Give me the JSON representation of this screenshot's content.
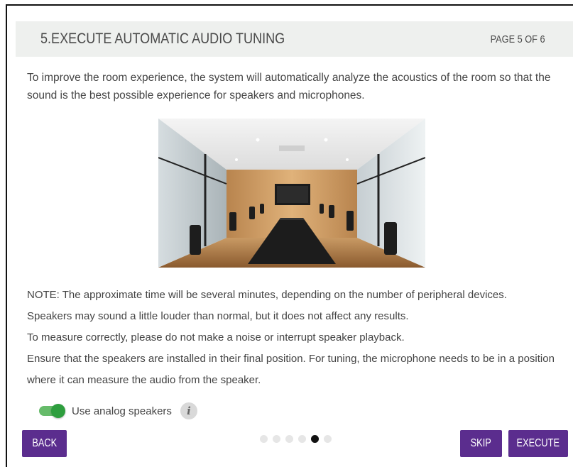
{
  "header": {
    "title": "5.EXECUTE AUTOMATIC AUDIO TUNING",
    "page_indicator": "PAGE 5 OF 6"
  },
  "intro": "To improve the room experience, the system will automatically analyze the acoustics of the room so that the sound is the best possible experience for speakers and microphones.",
  "notes": [
    "NOTE: The approximate time will be several minutes, depending on the number of peripheral devices.",
    "Speakers may sound a little louder than normal, but it does not affect any results.",
    "To measure correctly, please do not make a noise or interrupt speaker playback.",
    "Ensure that the speakers are installed in their final position. For tuning, the microphone needs to be in a position where it can measure the audio from the speaker."
  ],
  "toggle": {
    "label": "Use analog speakers",
    "state": "on",
    "info_icon": "info-icon"
  },
  "pagination": {
    "total": 6,
    "current": 5
  },
  "buttons": {
    "back": "BACK",
    "skip": "SKIP",
    "execute": "EXECUTE"
  },
  "colors": {
    "accent": "#5b2d8e",
    "toggle_on": "#2e9e3e",
    "header_bg": "#eef0ee"
  }
}
